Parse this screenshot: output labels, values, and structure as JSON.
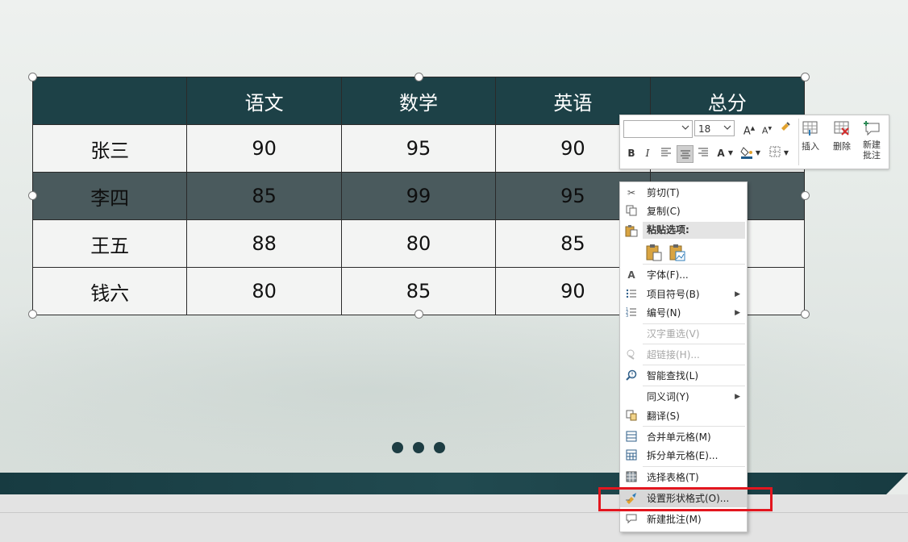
{
  "table": {
    "headers": [
      "",
      "语文",
      "数学",
      "英语",
      "总分"
    ],
    "rows": [
      [
        "张三",
        "90",
        "95",
        "90",
        ""
      ],
      [
        "李四",
        "85",
        "99",
        "95",
        ""
      ],
      [
        "王五",
        "88",
        "80",
        "85",
        ""
      ],
      [
        "钱六",
        "80",
        "85",
        "90",
        ""
      ]
    ]
  },
  "mini_toolbar": {
    "font_name": "",
    "font_size": "18",
    "bold": "B",
    "italic": "I",
    "font_color_letter": "A",
    "insert_label": "插入",
    "delete_label": "删除",
    "new_comment_label_1": "新建",
    "new_comment_label_2": "批注"
  },
  "context_menu": {
    "cut": "剪切(T)",
    "copy": "复制(C)",
    "paste_options": "粘贴选项:",
    "font": "字体(F)...",
    "bullets": "项目符号(B)",
    "numbering": "编号(N)",
    "reconversion": "汉字重选(V)",
    "hyperlink": "超链接(H)...",
    "smart_lookup": "智能查找(L)",
    "synonyms": "同义词(Y)",
    "translate": "翻译(S)",
    "merge_cells": "合并单元格(M)",
    "split_cells": "拆分单元格(E)...",
    "select_table": "选择表格(T)",
    "format_shape": "设置形状格式(O)...",
    "new_comment": "新建批注(M)"
  },
  "colors": {
    "header_bg": "#1d4147",
    "highlight_border": "#e3161f",
    "dark_row": "#4a5a5d"
  }
}
